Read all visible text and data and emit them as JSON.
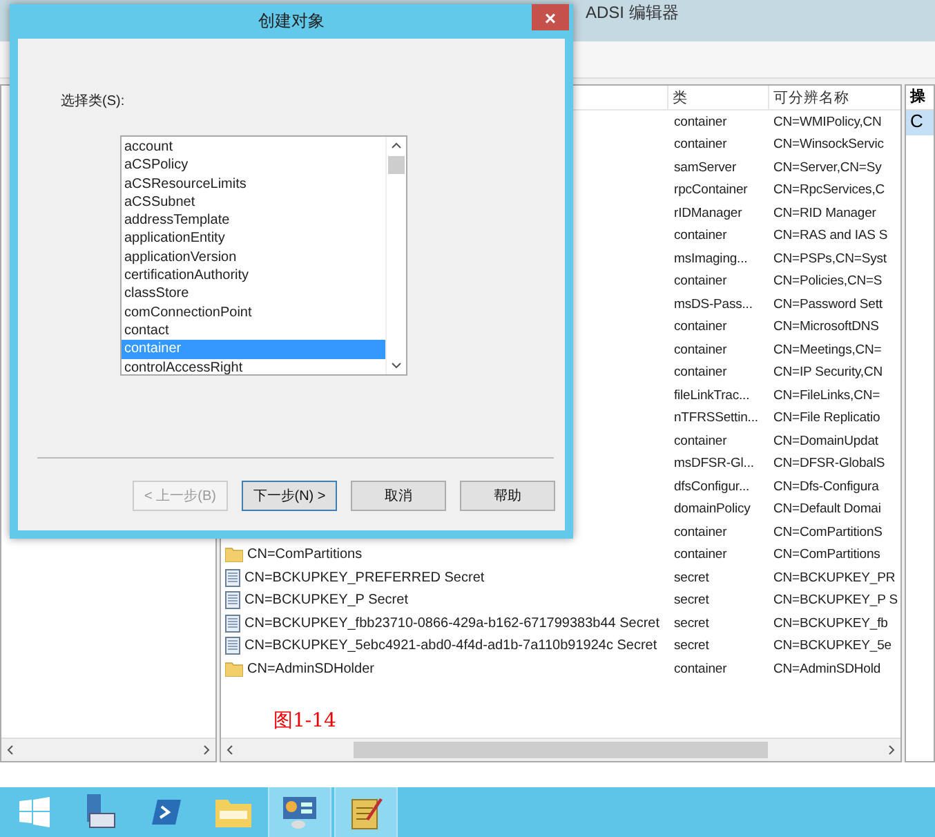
{
  "window": {
    "title": "ADSI 编辑器"
  },
  "list": {
    "columns": [
      "类",
      "可分辨名称"
    ],
    "rows": [
      {
        "class": "container",
        "dn": "CN=WMIPolicy,CN"
      },
      {
        "class": "container",
        "dn": "CN=WinsockServic"
      },
      {
        "class": "samServer",
        "dn": "CN=Server,CN=Sy"
      },
      {
        "class": "rpcContainer",
        "dn": "CN=RpcServices,C"
      },
      {
        "class": "rIDManager",
        "dn": "CN=RID Manager"
      },
      {
        "class": "container",
        "dn": "CN=RAS and IAS S"
      },
      {
        "class": "msImaging...",
        "dn": "CN=PSPs,CN=Syst"
      },
      {
        "class": "container",
        "dn": "CN=Policies,CN=S"
      },
      {
        "class": "msDS-Pass...",
        "dn": "CN=Password Sett"
      },
      {
        "class": "container",
        "dn": "CN=MicrosoftDNS"
      },
      {
        "class": "container",
        "dn": "CN=Meetings,CN="
      },
      {
        "class": "container",
        "dn": "CN=IP Security,CN"
      },
      {
        "class": "fileLinkTrac...",
        "dn": "CN=FileLinks,CN="
      },
      {
        "class": "nTFRSSettin...",
        "dn": "CN=File Replicatio"
      },
      {
        "class": "container",
        "dn": "CN=DomainUpdat"
      },
      {
        "class": "msDFSR-Gl...",
        "dn": "CN=DFSR-GlobalS"
      },
      {
        "class": "dfsConfigur...",
        "dn": "CN=Dfs-Configura"
      },
      {
        "class": "domainPolicy",
        "dn": "CN=Default Domai"
      },
      {
        "class": "container",
        "dn": "CN=ComPartitionS"
      },
      {
        "name": "CN=ComPartitions",
        "kind": "folder",
        "class": "container",
        "dn": "CN=ComPartitions"
      },
      {
        "name": "CN=BCKUPKEY_PREFERRED Secret",
        "kind": "secret",
        "class": "secret",
        "dn": "CN=BCKUPKEY_PR"
      },
      {
        "name": "CN=BCKUPKEY_P Secret",
        "kind": "secret",
        "class": "secret",
        "dn": "CN=BCKUPKEY_P S"
      },
      {
        "name": "CN=BCKUPKEY_fbb23710-0866-429a-b162-671799383b44 Secret",
        "kind": "secret",
        "class": "secret",
        "dn": "CN=BCKUPKEY_fb"
      },
      {
        "name": "CN=BCKUPKEY_5ebc4921-abd0-4f4d-ad1b-7a110b91924c Secret",
        "kind": "secret",
        "class": "secret",
        "dn": "CN=BCKUPKEY_5e"
      },
      {
        "name": "CN=AdminSDHolder",
        "kind": "folder",
        "class": "container",
        "dn": "CN=AdminSDHold"
      }
    ]
  },
  "caption": "图1-14",
  "actions": {
    "header": "操",
    "items": [
      {
        "label": "C",
        "selected": true
      }
    ]
  },
  "dialog": {
    "title": "创建对象",
    "close": "×",
    "label": "选择类(S):",
    "classes": [
      {
        "label": "account",
        "selected": false
      },
      {
        "label": "aCSPolicy",
        "selected": false
      },
      {
        "label": "aCSResourceLimits",
        "selected": false
      },
      {
        "label": "aCSSubnet",
        "selected": false
      },
      {
        "label": "addressTemplate",
        "selected": false
      },
      {
        "label": "applicationEntity",
        "selected": false
      },
      {
        "label": "applicationVersion",
        "selected": false
      },
      {
        "label": "certificationAuthority",
        "selected": false
      },
      {
        "label": "classStore",
        "selected": false
      },
      {
        "label": "comConnectionPoint",
        "selected": false
      },
      {
        "label": "contact",
        "selected": false
      },
      {
        "label": "container",
        "selected": true
      },
      {
        "label": "controlAccessRight",
        "selected": false
      }
    ],
    "buttons": [
      {
        "label": "< 上一步(B)",
        "disabled": true,
        "default": false
      },
      {
        "label": "下一步(N) >",
        "disabled": false,
        "default": true
      },
      {
        "label": "取消",
        "disabled": false,
        "default": false
      },
      {
        "label": "帮助",
        "disabled": false,
        "default": false
      }
    ]
  },
  "taskbar": [
    {
      "kind": "start",
      "active": false
    },
    {
      "kind": "server",
      "active": false
    },
    {
      "kind": "shell",
      "active": false
    },
    {
      "kind": "explorer",
      "active": false
    },
    {
      "kind": "panel",
      "active": true
    },
    {
      "kind": "notes",
      "active": true
    }
  ]
}
